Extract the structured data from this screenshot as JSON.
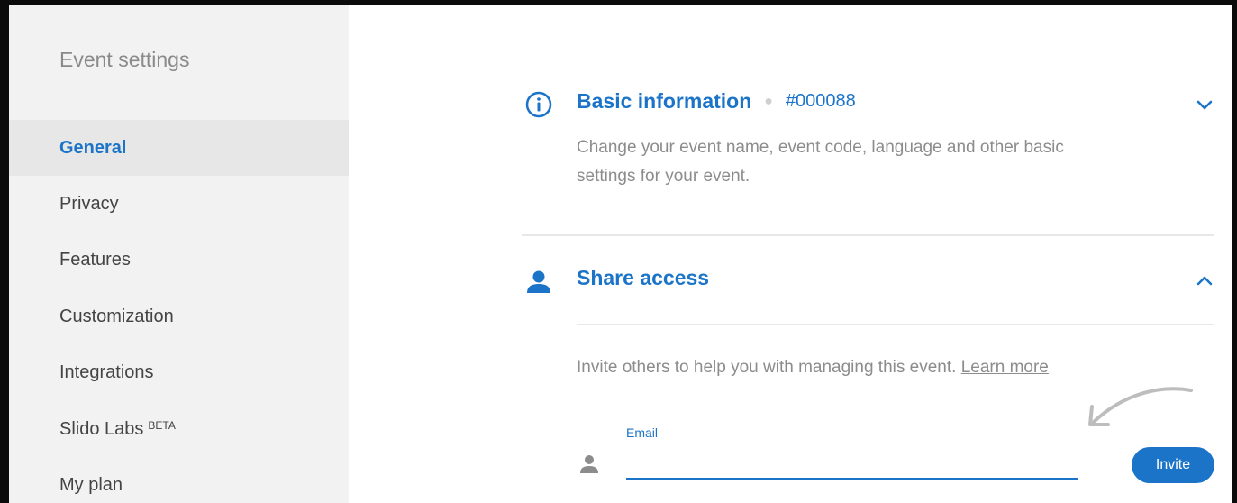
{
  "sidebar": {
    "title": "Event settings",
    "items": [
      {
        "label": "General",
        "active": true
      },
      {
        "label": "Privacy"
      },
      {
        "label": "Features"
      },
      {
        "label": "Customization"
      },
      {
        "label": "Integrations"
      },
      {
        "label": "Slido Labs",
        "badge": "BETA"
      },
      {
        "label": "My plan"
      }
    ]
  },
  "sections": {
    "basic": {
      "icon": "info-icon",
      "title": "Basic information",
      "code": "#000088",
      "description_line1": "Change your event name, event code, language and other basic",
      "description_line2": "settings for your event."
    },
    "share": {
      "icon": "person-icon",
      "title": "Share access",
      "description": "Invite others to help you with managing this event.",
      "learn_more": "Learn more",
      "email_label": "Email",
      "email_value": "",
      "invite_label": "Invite"
    }
  },
  "colors": {
    "accent": "#1b74c8",
    "sidebar_bg": "#f2f2f2",
    "active_bg": "#e7e7e7"
  }
}
